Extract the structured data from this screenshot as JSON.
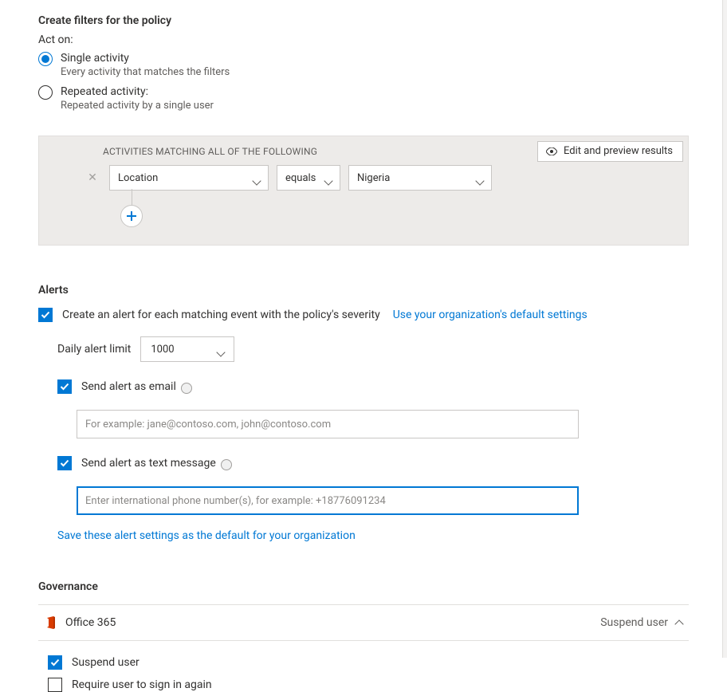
{
  "filters": {
    "title": "Create filters for the policy",
    "act_on_label": "Act on:",
    "single": {
      "label": "Single activity",
      "desc": "Every activity that matches the filters"
    },
    "repeated": {
      "label": "Repeated activity:",
      "desc": "Repeated activity by a single user"
    },
    "panel": {
      "edit_preview": "Edit and preview results",
      "heading": "ACTIVITIES MATCHING ALL OF THE FOLLOWING",
      "field": "Location",
      "op": "equals",
      "value": "Nigeria"
    }
  },
  "alerts": {
    "title": "Alerts",
    "create_label": "Create an alert for each matching event with the policy's severity",
    "use_default_link": "Use your organization's default settings",
    "daily_label": "Daily alert limit",
    "daily_value": "1000",
    "email_label": "Send alert as email",
    "email_placeholder": "For example: jane@contoso.com, john@contoso.com",
    "sms_label": "Send alert as text message",
    "sms_placeholder": "Enter international phone number(s), for example: +18776091234",
    "save_link": "Save these alert settings as the default for your organization"
  },
  "governance": {
    "title": "Governance",
    "office365": "Office 365",
    "summary": "Suspend user",
    "opt_suspend": "Suspend user",
    "opt_signin": "Require user to sign in again"
  }
}
